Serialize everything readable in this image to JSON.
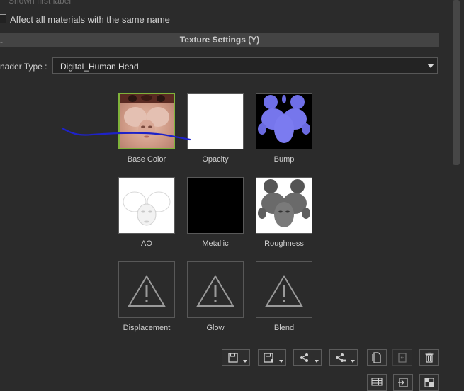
{
  "top_cut_label": "Shown first label",
  "affect_all": {
    "label": "Affect all materials with the same name",
    "checked": false
  },
  "section": {
    "title": "Texture Settings  (Y)",
    "collapse_glyph": "-"
  },
  "shader": {
    "label": "nader Type :",
    "value": "Digital_Human Head"
  },
  "slots": [
    {
      "key": "base_color",
      "label": "Base Color",
      "selected": true
    },
    {
      "key": "opacity",
      "label": "Opacity"
    },
    {
      "key": "bump",
      "label": "Bump"
    },
    {
      "key": "ao",
      "label": "AO"
    },
    {
      "key": "metallic",
      "label": "Metallic"
    },
    {
      "key": "roughness",
      "label": "Roughness"
    },
    {
      "key": "displacement",
      "label": "Displacement",
      "empty": true,
      "icon": "warning-icon"
    },
    {
      "key": "glow",
      "label": "Glow",
      "empty": true,
      "icon": "warning-icon"
    },
    {
      "key": "blend",
      "label": "Blend",
      "empty": true,
      "icon": "warning-icon"
    }
  ],
  "toolbar": {
    "row1": [
      "save-icon",
      "save-as-icon",
      "share-icon",
      "share-all-icon",
      "copy-icon",
      "paste-icon",
      "trash-icon"
    ],
    "row2": [
      "grid-icon",
      "import-icon",
      "checker-icon"
    ]
  },
  "annotation_color": "#1e22c8"
}
